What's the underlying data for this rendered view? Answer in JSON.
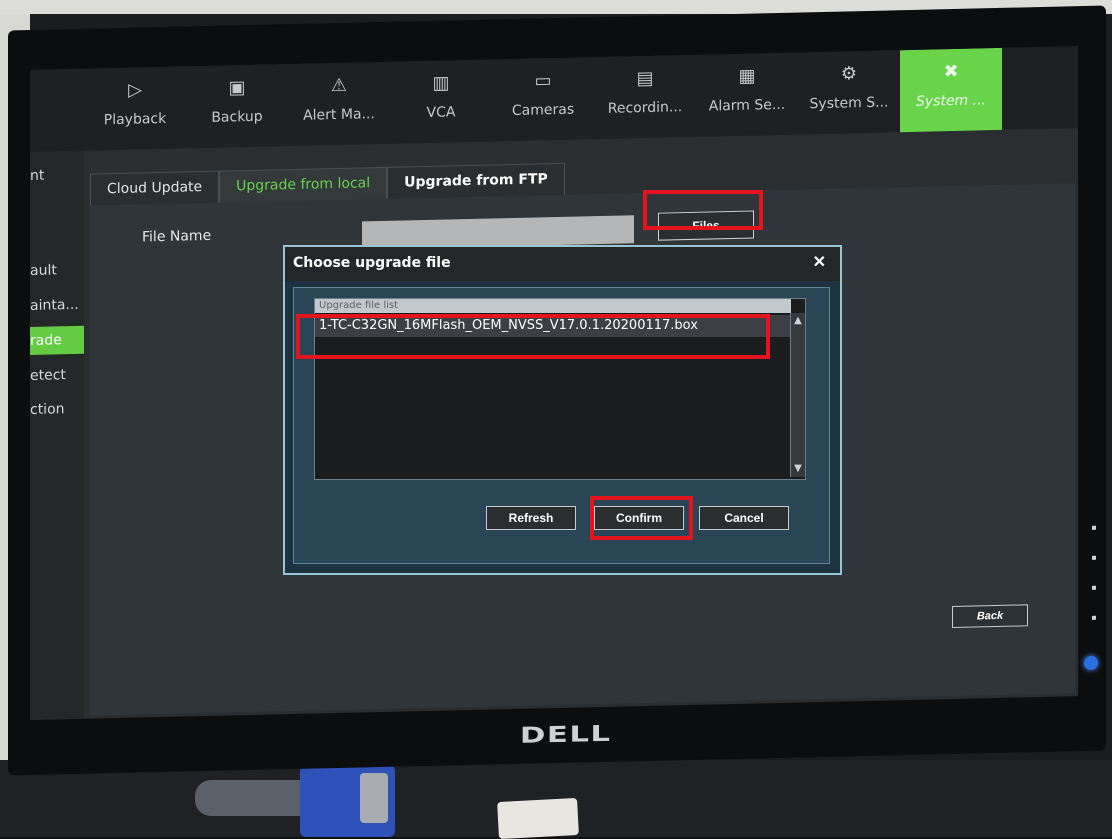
{
  "nav": {
    "items": [
      {
        "label": "Playback",
        "icon": "playback-icon"
      },
      {
        "label": "Backup",
        "icon": "floppy-icon"
      },
      {
        "label": "Alert Ma...",
        "icon": "alert-icon"
      },
      {
        "label": "VCA",
        "icon": "bars-icon"
      },
      {
        "label": "Cameras",
        "icon": "camera-icon"
      },
      {
        "label": "Recordin...",
        "icon": "recording-icon"
      },
      {
        "label": "Alarm Se...",
        "icon": "alarm-icon"
      },
      {
        "label": "System S...",
        "icon": "settings-icon"
      },
      {
        "label": "System ...",
        "icon": "tools-icon"
      }
    ]
  },
  "leftmenu": {
    "items": [
      {
        "label": "nt"
      },
      {
        "label": "ault"
      },
      {
        "label": "ainta..."
      },
      {
        "label": "rade"
      },
      {
        "label": "etect"
      },
      {
        "label": "ction"
      }
    ]
  },
  "tabs": [
    {
      "label": "Cloud Update"
    },
    {
      "label": "Upgrade from local"
    },
    {
      "label": "Upgrade from FTP"
    }
  ],
  "form": {
    "file_name_label": "File Name",
    "file_name_value": "",
    "files_button": "Files"
  },
  "dialog": {
    "title": "Choose upgrade file",
    "list_header": "Upgrade file list",
    "files": [
      "1-TC-C32GN_16MFlash_OEM_NVSS_V17.0.1.20200117.box"
    ],
    "buttons": {
      "refresh": "Refresh",
      "confirm": "Confirm",
      "cancel": "Cancel"
    }
  },
  "back_button": "Back",
  "brand": "DELL",
  "colors": {
    "accent": "#69d34a",
    "annotation": "#e3141d"
  }
}
